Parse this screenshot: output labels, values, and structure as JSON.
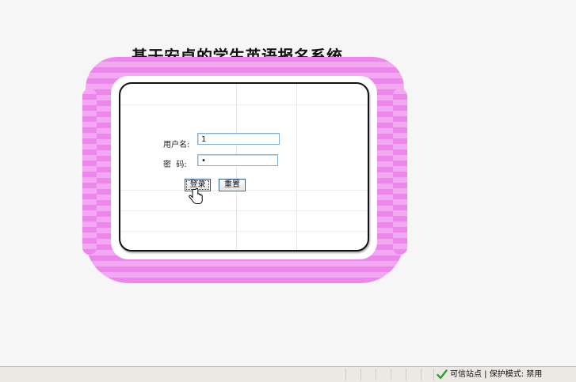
{
  "page": {
    "title": "基于安卓的学生英语报名系统"
  },
  "login_form": {
    "username_label": "用户名:",
    "username_value": "1",
    "password_label": "密  码:",
    "password_value": "•",
    "login_button": "登录",
    "reset_button": "重置"
  },
  "statusbar": {
    "zone_text": "可信站点 | 保护模式: 禁用"
  },
  "icons": {
    "cursor": "hand-pointer-icon",
    "zone": "check-icon"
  },
  "colors": {
    "frame_pink": "#ee86ee",
    "frame_pink_light": "#f4a8f4",
    "input_border": "#7fb0d6",
    "check_green": "#2f9e2f"
  }
}
